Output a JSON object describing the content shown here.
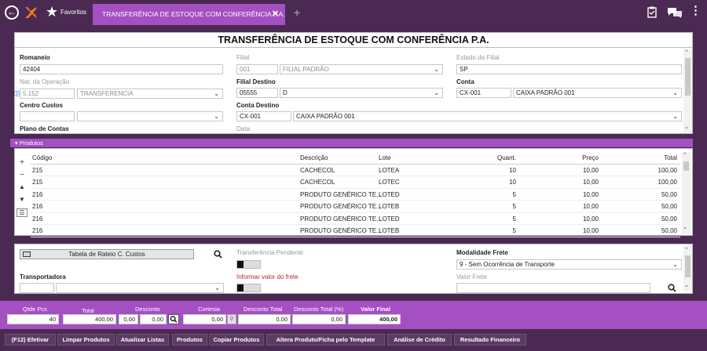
{
  "app": {
    "favorites_label": "Favoritos",
    "tab_title": "TRANSFERÊNCIA DE ESTOQUE COM CONFERÊNCIA P.A.",
    "brand_color": "#a44fc2",
    "bg_color": "#4a2a52"
  },
  "form": {
    "title": "TRANSFERÊNCIA DE ESTOQUE COM CONFERÊNCIA P.A.",
    "romaneio": {
      "label": "Romaneio",
      "value": "42404"
    },
    "filial": {
      "label": "Filial",
      "code": "001",
      "name": "FILIAL PADRÃO"
    },
    "estado_filial": {
      "label": "Estado da Filial",
      "value": "SP"
    },
    "nat_operacao": {
      "label": "Nat. da Operação",
      "code": "5.152",
      "name": "TRANSFERENCIA"
    },
    "filial_destino": {
      "label": "Filial Destino",
      "code": "05555",
      "name": "D"
    },
    "conta": {
      "label": "Conta",
      "code": "CX-001",
      "name": "CAIXA PADRÃO 001"
    },
    "centro_custos": {
      "label": "Centro Custos",
      "code": "",
      "name": ""
    },
    "conta_destino": {
      "label": "Conta Destino",
      "code": "CX-001",
      "name": "CAIXA PADRÃO 001"
    },
    "plano_contas": {
      "label": "Plano de Contas"
    },
    "data": {
      "label": "Data"
    }
  },
  "produtos": {
    "header": "Produtos",
    "columns": {
      "codigo": "Código",
      "descricao": "Descrição",
      "lote": "Lote",
      "quant": "Quant.",
      "preco": "Preço",
      "total": "Total"
    },
    "rows": [
      {
        "codigo": "215",
        "descricao": "CACHECOL",
        "lote": "LOTEA",
        "quant": "10",
        "preco": "10,00",
        "total": "100,00"
      },
      {
        "codigo": "215",
        "descricao": "CACHECOL",
        "lote": "LOTEC",
        "quant": "10",
        "preco": "10,00",
        "total": "100,00"
      },
      {
        "codigo": "216",
        "descricao": "PRODUTO GENÉRICO TE...",
        "lote": "LOTED",
        "quant": "5",
        "preco": "10,00",
        "total": "50,00"
      },
      {
        "codigo": "216",
        "descricao": "PRODUTO GENÉRICO TE...",
        "lote": "LOTEB",
        "quant": "5",
        "preco": "10,00",
        "total": "50,00"
      },
      {
        "codigo": "216",
        "descricao": "PRODUTO GENÉRICO TE...",
        "lote": "LOTED",
        "quant": "5",
        "preco": "10,00",
        "total": "50,00"
      },
      {
        "codigo": "216",
        "descricao": "PRODUTO GENÉRICO TE...",
        "lote": "LOTEB",
        "quant": "5",
        "preco": "10,00",
        "total": "50,00"
      }
    ]
  },
  "extra": {
    "rateio_button": "Tabela de Rateio C. Custos",
    "transferencia_pendente": "Transferência Pendente",
    "informar_frete": "Informar valor do frete",
    "transportadora": "Transportadora",
    "modalidade_frete": {
      "label": "Modalidade Frete",
      "value": "9 - Sem Ocorrência de Transporte"
    },
    "valor_frete": {
      "label": "Valor Frete",
      "value": ""
    }
  },
  "totals": {
    "qtde_pcs": {
      "label": "Qtde Pcs",
      "value": "40"
    },
    "total": {
      "label": "Total",
      "value": "400,00"
    },
    "desconto": {
      "label": "Desconto",
      "value1": "0,00",
      "value2": "0,00"
    },
    "cortesia": {
      "label": "Cortesia",
      "value": "0,00"
    },
    "desconto_total": {
      "label": "Desconto Total",
      "value": "0,00"
    },
    "desconto_total_pct": {
      "label": "Desconto Total (%)",
      "value": "0,00"
    },
    "valor_final": {
      "label": "Valor Final",
      "value": "400,00"
    }
  },
  "actions": [
    "(F12) Efetivar",
    "Limpar Produtos",
    "Atualizar Listas",
    "Produtos",
    "Copiar Produtos",
    "Altera Produto/Ficha pelo Template",
    "Análise de Crédito",
    "Resultado Financeiro"
  ]
}
